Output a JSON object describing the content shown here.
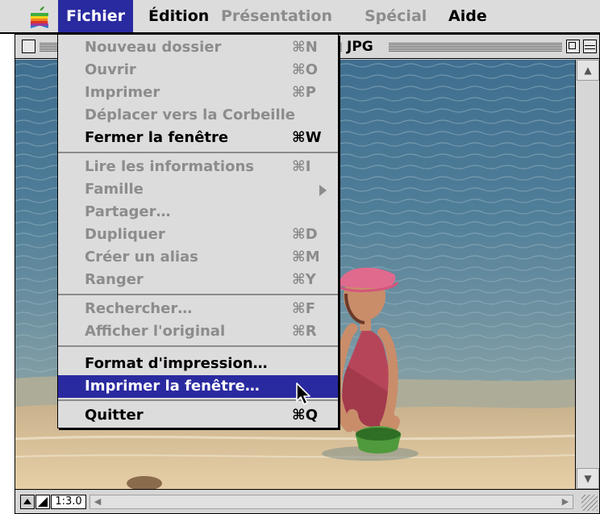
{
  "menubar": {
    "items": [
      {
        "label": "Fichier",
        "state": "active"
      },
      {
        "label": "Édition",
        "state": "enabled"
      },
      {
        "label": "Présentation",
        "state": "disabled"
      },
      {
        "label": "Spécial",
        "state": "disabled"
      },
      {
        "label": "Aide",
        "state": "enabled"
      }
    ],
    "apple_icon": "apple-menu-icon"
  },
  "window": {
    "title": "JPG",
    "content": "photo of a child in a pink cap and swimsuit kneeling at the water's edge holding a green bucket",
    "zoom_readout": "1:3.0"
  },
  "fichier_menu": {
    "items": [
      {
        "label": "Nouveau dossier",
        "shortcut": "⌘N",
        "enabled": false
      },
      {
        "label": "Ouvrir",
        "shortcut": "⌘O",
        "enabled": false
      },
      {
        "label": "Imprimer",
        "shortcut": "⌘P",
        "enabled": false
      },
      {
        "label": "Déplacer vers la Corbeille",
        "shortcut": "",
        "enabled": false
      },
      {
        "label": "Fermer la fenêtre",
        "shortcut": "⌘W",
        "enabled": true
      },
      {
        "label": "Lire les informations",
        "shortcut": "⌘I",
        "enabled": false
      },
      {
        "label": "Famille",
        "shortcut": "",
        "enabled": false,
        "submenu": true
      },
      {
        "label": "Partager…",
        "shortcut": "",
        "enabled": false
      },
      {
        "label": "Dupliquer",
        "shortcut": "⌘D",
        "enabled": false
      },
      {
        "label": "Créer un alias",
        "shortcut": "⌘M",
        "enabled": false
      },
      {
        "label": "Ranger",
        "shortcut": "⌘Y",
        "enabled": false
      },
      {
        "label": "Rechercher…",
        "shortcut": "⌘F",
        "enabled": false
      },
      {
        "label": "Afficher l'original",
        "shortcut": "⌘R",
        "enabled": false
      },
      {
        "label": "Format d'impression…",
        "shortcut": "",
        "enabled": true
      },
      {
        "label": "Imprimer la fenêtre…",
        "shortcut": "",
        "enabled": true,
        "highlighted": true
      },
      {
        "label": "Quitter",
        "shortcut": "⌘Q",
        "enabled": true
      }
    ]
  },
  "colors": {
    "menu_highlight": "#2a2aa0",
    "menu_background": "#dcdcdc",
    "disabled_text": "#8c8c8c"
  }
}
